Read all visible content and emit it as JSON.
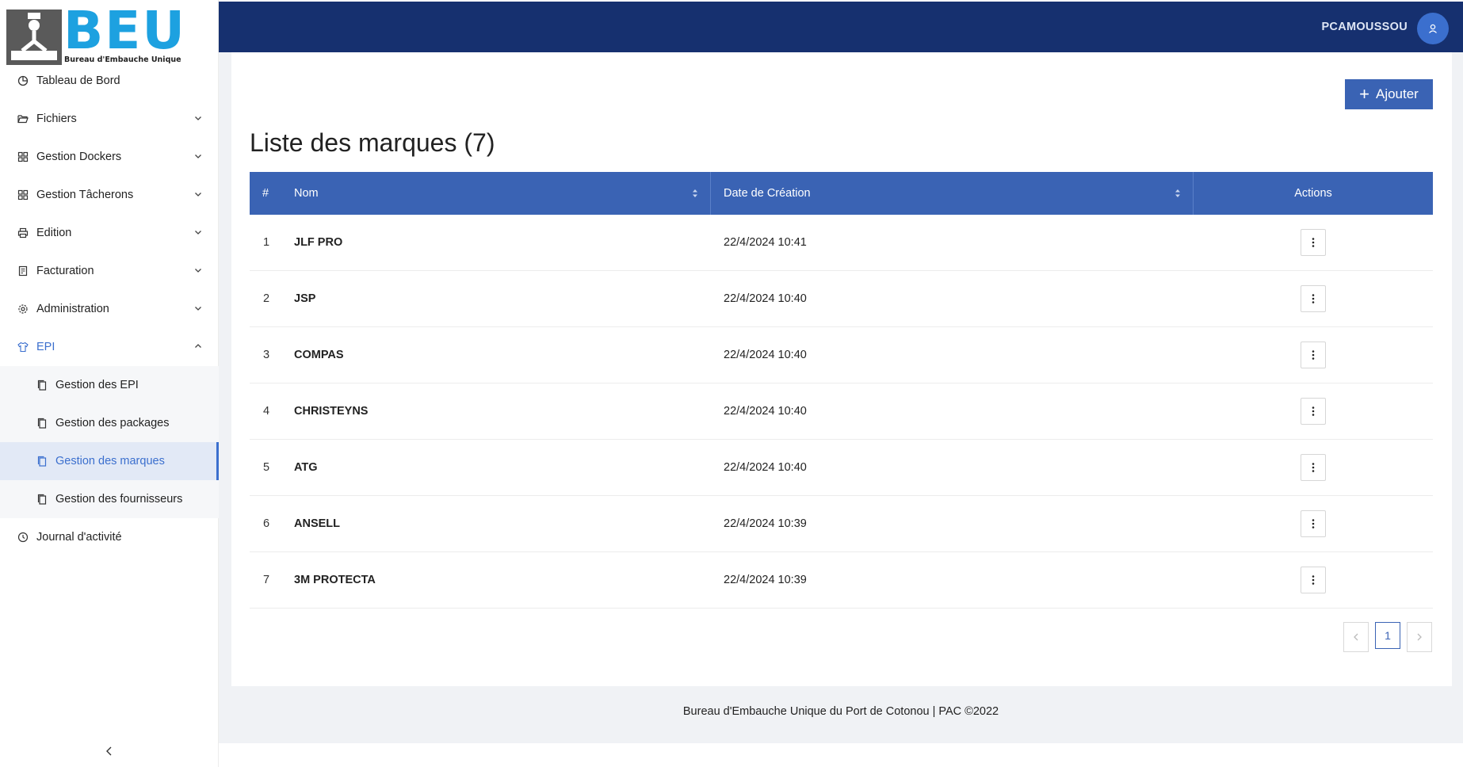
{
  "brand": {
    "letters": "BEU",
    "subtitle": "Bureau d'Embauche Unique"
  },
  "sidebar": {
    "items": [
      {
        "label": "Tableau de Bord",
        "icon": "pie-chart-icon",
        "has_chevron": false
      },
      {
        "label": "Fichiers",
        "icon": "folder-open-icon",
        "has_chevron": true
      },
      {
        "label": "Gestion Dockers",
        "icon": "grid-icon",
        "has_chevron": true
      },
      {
        "label": "Gestion Tâcherons",
        "icon": "grid-icon",
        "has_chevron": true
      },
      {
        "label": "Edition",
        "icon": "printer-icon",
        "has_chevron": true
      },
      {
        "label": "Facturation",
        "icon": "invoice-icon",
        "has_chevron": true
      },
      {
        "label": "Administration",
        "icon": "gear-icon",
        "has_chevron": true
      },
      {
        "label": "EPI",
        "icon": "shirt-icon",
        "has_chevron": true,
        "open": true
      }
    ],
    "epi_subitems": [
      {
        "label": "Gestion des EPI",
        "icon": "copy-icon"
      },
      {
        "label": "Gestion des packages",
        "icon": "copy-icon"
      },
      {
        "label": "Gestion des marques",
        "icon": "copy-icon",
        "active": true
      },
      {
        "label": "Gestion des fournisseurs",
        "icon": "copy-icon"
      }
    ],
    "journal": {
      "label": "Journal d'activité",
      "icon": "clock-icon"
    }
  },
  "topbar": {
    "username": "PCAMOUSSOU"
  },
  "main": {
    "add_button_label": "Ajouter",
    "title": "Liste des marques (7)",
    "table": {
      "headers": {
        "idx": "#",
        "name": "Nom",
        "date": "Date de Création",
        "actions": "Actions"
      },
      "rows": [
        {
          "idx": "1",
          "name": "JLF PRO",
          "date": "22/4/2024 10:41"
        },
        {
          "idx": "2",
          "name": "JSP",
          "date": "22/4/2024 10:40"
        },
        {
          "idx": "3",
          "name": "COMPAS",
          "date": "22/4/2024 10:40"
        },
        {
          "idx": "4",
          "name": "CHRISTEYNS",
          "date": "22/4/2024 10:40"
        },
        {
          "idx": "5",
          "name": "ATG",
          "date": "22/4/2024 10:40"
        },
        {
          "idx": "6",
          "name": "ANSELL",
          "date": "22/4/2024 10:39"
        },
        {
          "idx": "7",
          "name": "3M PROTECTA",
          "date": "22/4/2024 10:39"
        }
      ]
    },
    "pagination": {
      "current_page": "1"
    }
  },
  "footer": {
    "text": "Bureau d'Embauche Unique du Port de Cotonou | PAC ©2022"
  },
  "colors": {
    "topbar": "#16306f",
    "accent": "#3a63b4",
    "brand_blue": "#1da1e0"
  }
}
